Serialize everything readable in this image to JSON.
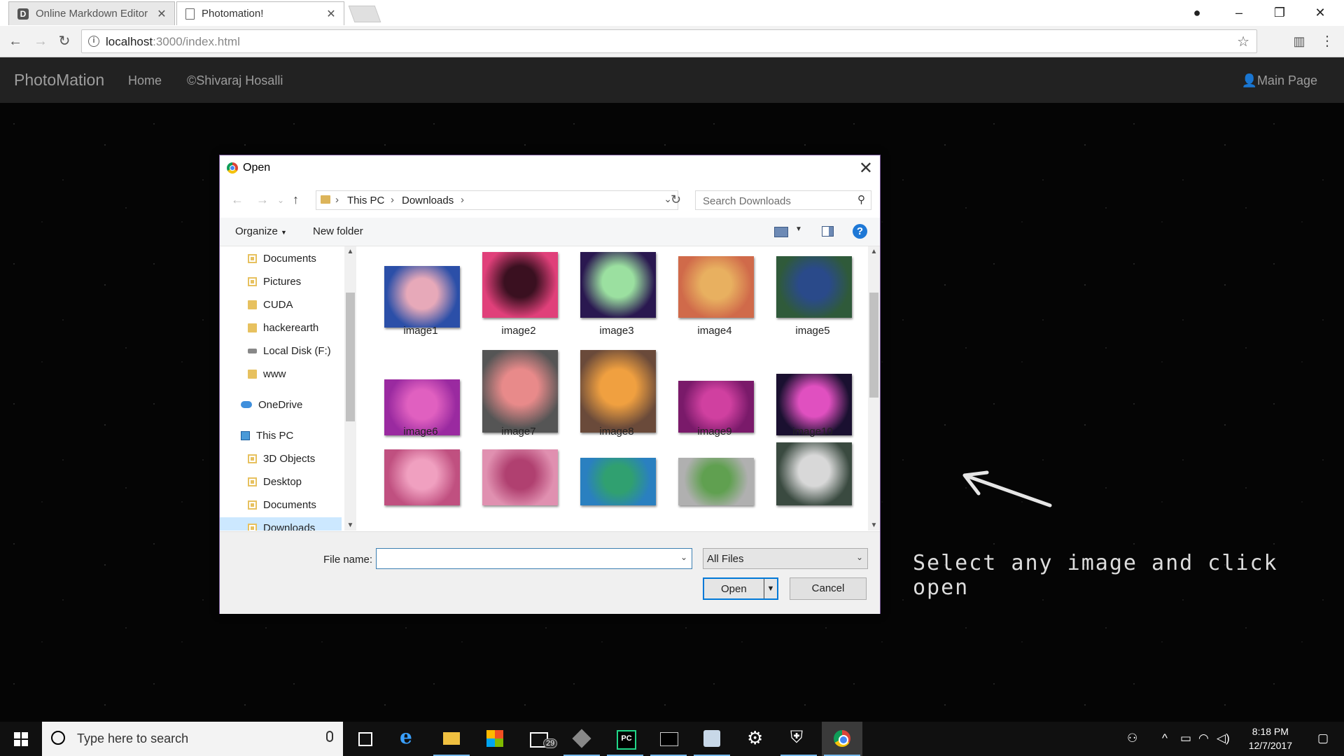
{
  "browser": {
    "tabs": [
      {
        "title": "Online Markdown Editor",
        "favicon": "D"
      },
      {
        "title": "Photomation!"
      }
    ],
    "url_host": "localhost",
    "url_path": ":3000/index.html"
  },
  "navbar": {
    "brand": "PhotoMation",
    "links": [
      "Home",
      "©Shivaraj Hosalli"
    ],
    "right_link": "Main Page"
  },
  "page": {
    "hint": "Select any image and click open"
  },
  "dialog": {
    "title": "Open",
    "breadcrumb": [
      "This PC",
      "Downloads"
    ],
    "search_placeholder": "Search Downloads",
    "organize": "Organize",
    "new_folder": "New folder",
    "help": "?",
    "nav_items": [
      {
        "label": "Documents",
        "icon": "document-folder-icon",
        "pinned": true
      },
      {
        "label": "Pictures",
        "icon": "pictures-folder-icon",
        "pinned": true
      },
      {
        "label": "CUDA",
        "icon": "folder-icon"
      },
      {
        "label": "hackerearth",
        "icon": "folder-icon"
      },
      {
        "label": "Local Disk (F:)",
        "icon": "disk-icon"
      },
      {
        "label": "www",
        "icon": "folder-icon"
      },
      {
        "label": "OneDrive",
        "icon": "onedrive-icon"
      },
      {
        "label": "This PC",
        "icon": "this-pc-icon"
      },
      {
        "label": "3D Objects",
        "icon": "3d-objects-folder-icon"
      },
      {
        "label": "Desktop",
        "icon": "desktop-folder-icon"
      },
      {
        "label": "Documents",
        "icon": "document-folder-icon"
      },
      {
        "label": "Downloads",
        "icon": "downloads-folder-icon",
        "selected": true
      }
    ],
    "files": [
      {
        "label": "image1",
        "colors": [
          "#2b4fa8",
          "#e7a9b9"
        ]
      },
      {
        "label": "image2",
        "colors": [
          "#e0407a",
          "#3a1020"
        ]
      },
      {
        "label": "image3",
        "colors": [
          "#2a1850",
          "#9be0a0"
        ]
      },
      {
        "label": "image4",
        "colors": [
          "#d06a4a",
          "#e8b060"
        ]
      },
      {
        "label": "image5",
        "colors": [
          "#2f5a3a",
          "#2a4a8a"
        ]
      },
      {
        "label": "image6",
        "colors": [
          "#9a2aa0",
          "#e060c0"
        ]
      },
      {
        "label": "image7",
        "colors": [
          "#555555",
          "#e88a8a"
        ]
      },
      {
        "label": "image8",
        "colors": [
          "#6a4a3a",
          "#f0a040"
        ]
      },
      {
        "label": "image9",
        "colors": [
          "#7a1a6a",
          "#d040a0"
        ]
      },
      {
        "label": "image10",
        "colors": [
          "#1a1030",
          "#e050c0"
        ]
      },
      {
        "label": "",
        "colors": [
          "#c05080",
          "#f0a0c0"
        ]
      },
      {
        "label": "",
        "colors": [
          "#e090b0",
          "#b04070"
        ]
      },
      {
        "label": "",
        "colors": [
          "#2a80c0",
          "#30a070"
        ]
      },
      {
        "label": "",
        "colors": [
          "#b0b0b0",
          "#60a050"
        ]
      },
      {
        "label": "",
        "colors": [
          "#3a4a40",
          "#d8d8d8"
        ]
      }
    ],
    "file_name_label": "File name:",
    "file_name_value": "",
    "filter": "All Files",
    "open": "Open",
    "cancel": "Cancel"
  },
  "taskbar": {
    "search_placeholder": "Type here to search",
    "mail_badge": "29",
    "time": "8:18 PM",
    "date": "12/7/2017"
  },
  "colors": {
    "navbar_bg": "#222222",
    "accent": "#0078d7",
    "selected_nav": "#cce8ff"
  }
}
